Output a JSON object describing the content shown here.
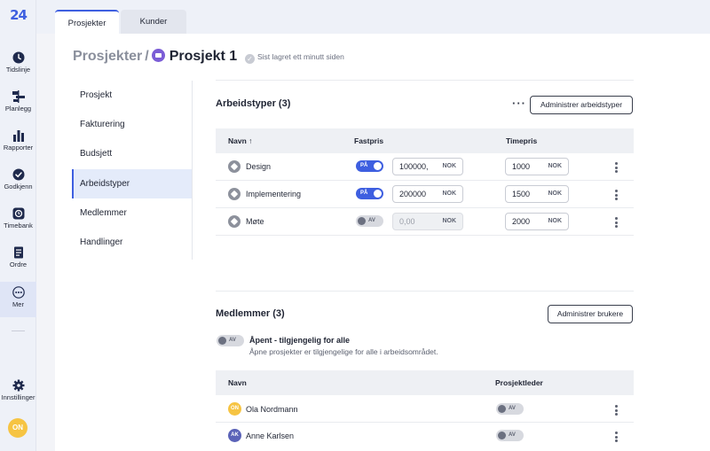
{
  "app": {
    "logo": {
      "big": "24",
      "small": "SevenOffice"
    },
    "nav": [
      {
        "label": "Tidslinje",
        "icon": "clock-icon"
      },
      {
        "label": "Planlegg",
        "icon": "planner-icon"
      },
      {
        "label": "Rapporter",
        "icon": "chart-icon"
      },
      {
        "label": "Godkjenn",
        "icon": "check-circle-icon"
      },
      {
        "label": "Timebank",
        "icon": "timebank-icon"
      },
      {
        "label": "Ordre",
        "icon": "order-icon"
      },
      {
        "label": "Mer",
        "icon": "more-icon"
      }
    ],
    "settings_label": "Innstillinger",
    "user_initials": "ON"
  },
  "tabs": [
    {
      "label": "Prosjekter"
    },
    {
      "label": "Kunder"
    }
  ],
  "header": {
    "breadcrumb": "Prosjekter",
    "separator": "/",
    "title": "Prosjekt 1",
    "saved_status": "Sist lagret ett minutt siden"
  },
  "left_menu": [
    {
      "label": "Prosjekt"
    },
    {
      "label": "Fakturering"
    },
    {
      "label": "Budsjett"
    },
    {
      "label": "Arbeidstyper"
    },
    {
      "label": "Medlemmer"
    },
    {
      "label": "Handlinger"
    }
  ],
  "work_types": {
    "title": "Arbeidstyper (3)",
    "manage_button": "Administrer arbeidstyper",
    "columns": {
      "name": "Navn ↑",
      "fixed": "Fastpris",
      "hourly": "Timepris"
    },
    "rows": [
      {
        "name": "Design",
        "toggle": "PÅ",
        "fixed_value": "100000,",
        "fixed_currency": "NOK",
        "hourly_value": "1000",
        "hourly_currency": "NOK",
        "on": true
      },
      {
        "name": "Implementering",
        "toggle": "PÅ",
        "fixed_value": "200000",
        "fixed_currency": "NOK",
        "hourly_value": "1500",
        "hourly_currency": "NOK",
        "on": true
      },
      {
        "name": "Møte",
        "toggle": "AV",
        "fixed_value": "0,00",
        "fixed_currency": "NOK",
        "hourly_value": "2000",
        "hourly_currency": "NOK",
        "on": false
      }
    ]
  },
  "members": {
    "title": "Medlemmer (3)",
    "manage_button": "Administrer brukere",
    "open_toggle": "AV",
    "open_title": "Åpent - tilgjengelig for alle",
    "open_desc": "Åpne prosjekter er tilgjengelige for alle i arbeidsområdet.",
    "columns": {
      "name": "Navn",
      "leader": "Prosjektleder"
    },
    "rows": [
      {
        "initials": "ON",
        "name": "Ola Nordmann",
        "toggle": "AV",
        "color": "#f6c443"
      },
      {
        "initials": "AK",
        "name": "Anne Karlsen",
        "toggle": "AV",
        "color": "#5b63b8"
      }
    ]
  }
}
